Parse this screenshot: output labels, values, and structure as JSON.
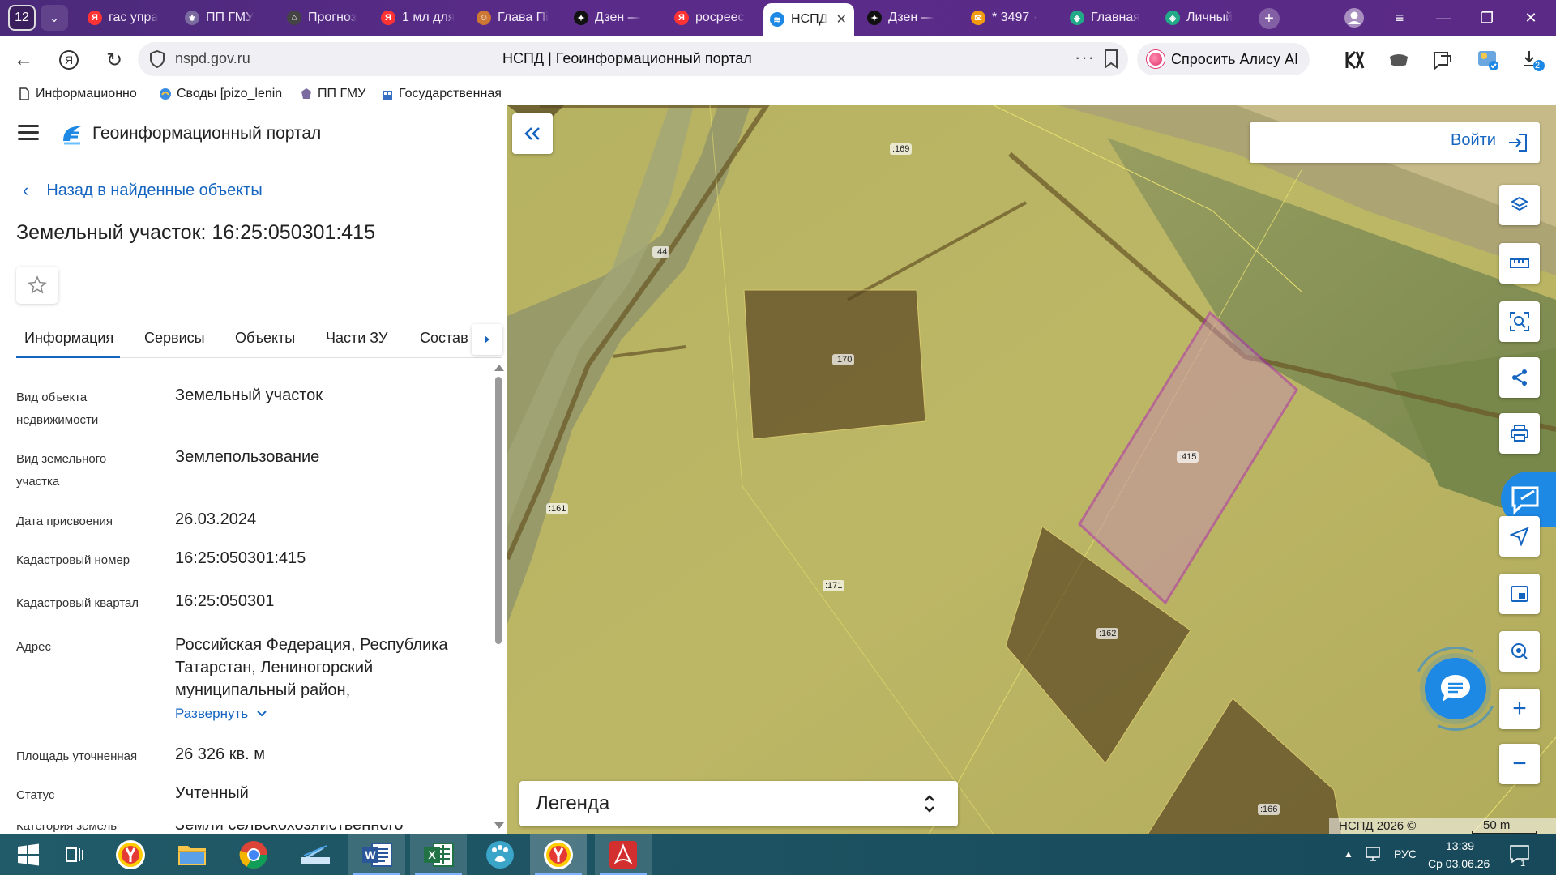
{
  "browser": {
    "tab_count": "12",
    "tabs": [
      {
        "label": "гас упра",
        "fav": "Я",
        "color": "#f33"
      },
      {
        "label": "ПП ГМУ",
        "fav": "⚜",
        "color": "#7a6aa0"
      },
      {
        "label": "Прогноз",
        "fav": "⌂",
        "color": "#444"
      },
      {
        "label": "1 мл для",
        "fav": "Я",
        "color": "#f33"
      },
      {
        "label": "Глава Пі",
        "fav": "☺",
        "color": "#c73"
      },
      {
        "label": "Дзен — ",
        "fav": "✦",
        "color": "#111"
      },
      {
        "label": "росреес",
        "fav": "Я",
        "color": "#f33"
      },
      {
        "label": "НСПД",
        "fav": "≋",
        "color": "#1e88e5"
      },
      {
        "label": "Дзен — ",
        "fav": "✦",
        "color": "#111"
      },
      {
        "label": "* 3497 · ",
        "fav": "✉",
        "color": "#f39c12"
      },
      {
        "label": "Главная",
        "fav": "◈",
        "color": "#2a8"
      },
      {
        "label": "Личный",
        "fav": "◈",
        "color": "#2a8"
      }
    ],
    "url_domain": "nspd.gov.ru",
    "page_title": "НСПД | Геоинформационный портал",
    "url_more": "···",
    "alice_label": "Спросить Алису AI",
    "downloads_badge": "2",
    "bookmarks": [
      {
        "label": "Информационно"
      },
      {
        "label": "Своды [pizo_lenin"
      },
      {
        "label": "ПП ГМУ"
      },
      {
        "label": "Государственная"
      }
    ]
  },
  "panel": {
    "portal_title": "Геоинформационный портал",
    "back_label": "Назад в найденные объекты",
    "object_title": "Земельный участок: 16:25:050301:415",
    "tabs": [
      "Информация",
      "Сервисы",
      "Объекты",
      "Части ЗУ",
      "Состав"
    ],
    "active_tab": "Информация",
    "rows": [
      {
        "label": "Вид объекта недвижимости",
        "value": "Земельный участок"
      },
      {
        "label": "Вид земельного участка",
        "value": "Землепользование"
      },
      {
        "label": "Дата присвоения",
        "value": "26.03.2024"
      },
      {
        "label": "Кадастровый номер",
        "value": "16:25:050301:415"
      },
      {
        "label": "Кадастровый квартал",
        "value": "16:25:050301"
      },
      {
        "label": "Адрес",
        "value": "Российская Федерация, Республика Татарстан, Лениногорский муниципальный район,"
      },
      {
        "label": "Площадь уточненная",
        "value": "26 326 кв. м"
      },
      {
        "label": "Статус",
        "value": "Учтенный"
      },
      {
        "label": "Категория земель",
        "value": "Земли сельскохозяйственного"
      }
    ],
    "expand_label": "Развернуть"
  },
  "map": {
    "login_label": "Войти",
    "legend_label": "Легенда",
    "attribution": "НСПД 2026 ©",
    "scale_label": "50 m",
    "plot_labels": [
      ":169",
      ":44",
      ":170",
      ":415",
      ":161",
      ":171",
      ":162",
      ":166"
    ],
    "colors": {
      "selected_outline": "#b02ab8",
      "selected_fill": "#c48fa8",
      "parcel_fill": "#e6e07a",
      "accent": "#1565c0"
    }
  },
  "taskbar": {
    "lang": "РУС",
    "time": "13:39",
    "date": "Ср 03.06.26",
    "notif_count": "1"
  }
}
